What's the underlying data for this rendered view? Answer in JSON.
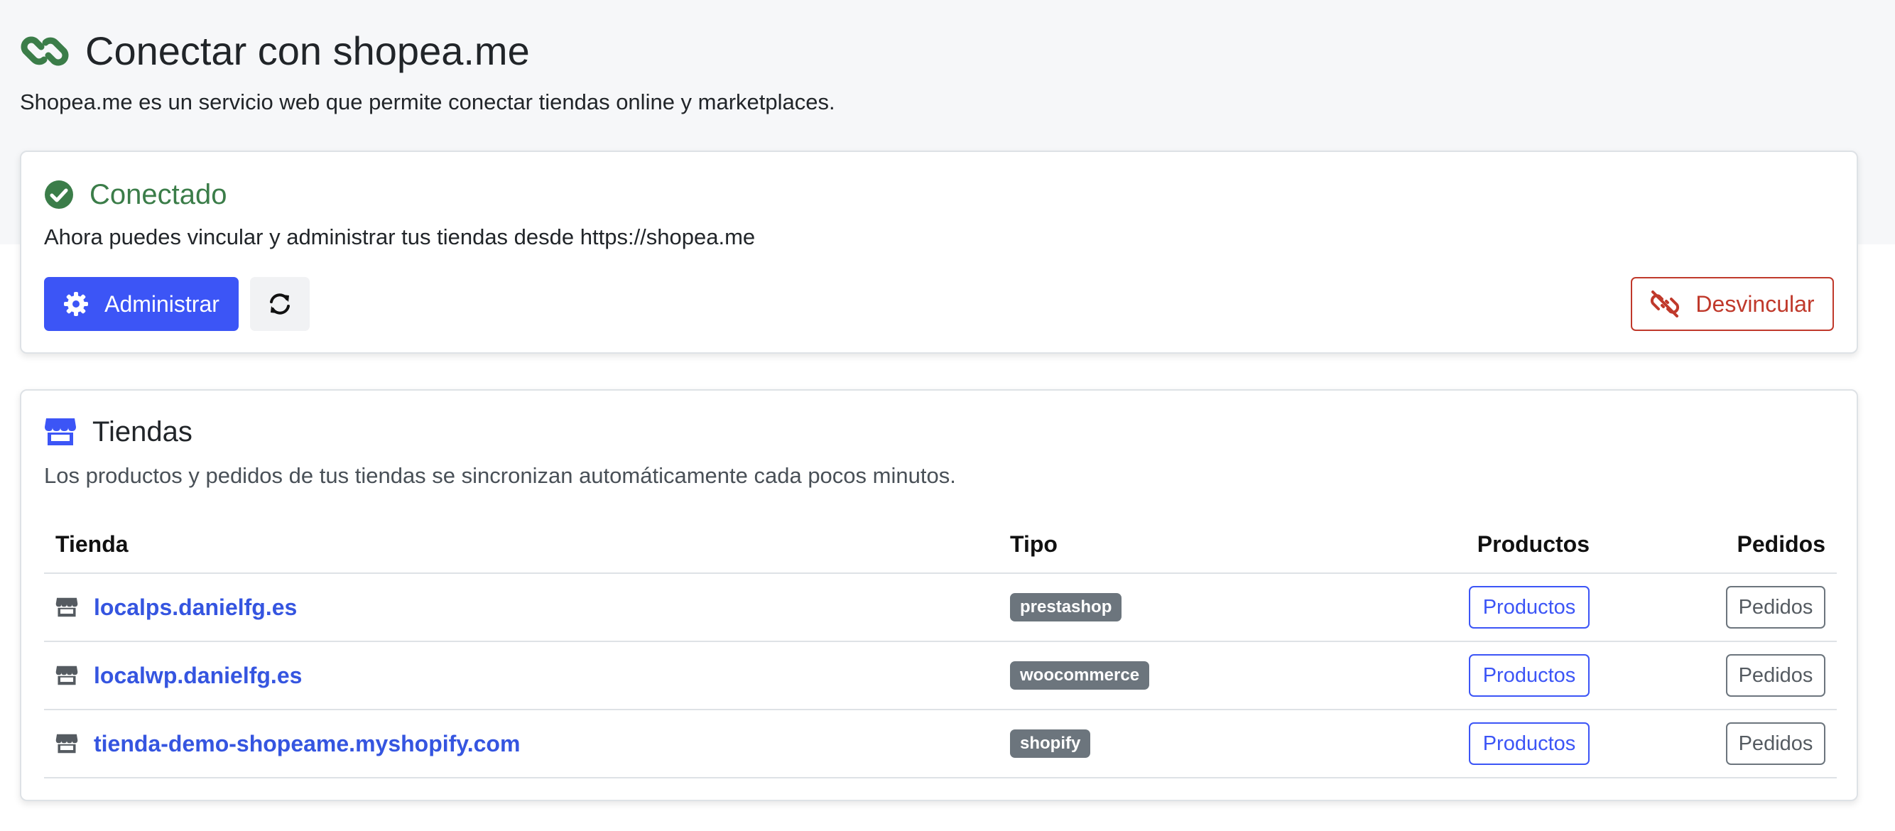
{
  "header": {
    "title": "Conectar con shopea.me",
    "subtitle": "Shopea.me es un servicio web que permite conectar tiendas online y marketplaces."
  },
  "connection": {
    "status": "Conectado",
    "description": "Ahora puedes vincular y administrar tus tiendas desde https://shopea.me",
    "admin_label": "Administrar",
    "unlink_label": "Desvincular"
  },
  "stores": {
    "title": "Tiendas",
    "description": "Los productos y pedidos de tus tiendas se sincronizan automáticamente cada pocos minutos.",
    "columns": {
      "store": "Tienda",
      "type": "Tipo",
      "products": "Productos",
      "orders": "Pedidos"
    },
    "rows": [
      {
        "name": "localps.danielfg.es",
        "type": "prestashop",
        "products_label": "Productos",
        "orders_label": "Pedidos"
      },
      {
        "name": "localwp.danielfg.es",
        "type": "woocommerce",
        "products_label": "Productos",
        "orders_label": "Pedidos"
      },
      {
        "name": "tienda-demo-shopeame.myshopify.com",
        "type": "shopify",
        "products_label": "Productos",
        "orders_label": "Pedidos"
      }
    ]
  },
  "icons": {
    "title": "link-icon",
    "status": "check-circle-icon",
    "admin": "gear-icon",
    "refresh": "refresh-icon",
    "unlink": "unlink-icon",
    "stores": "store-icon"
  },
  "colors": {
    "primary": "#3c55f6",
    "success": "#3b7d49",
    "danger": "#c0392b",
    "badge": "#6c757d",
    "link": "#3555e0"
  }
}
